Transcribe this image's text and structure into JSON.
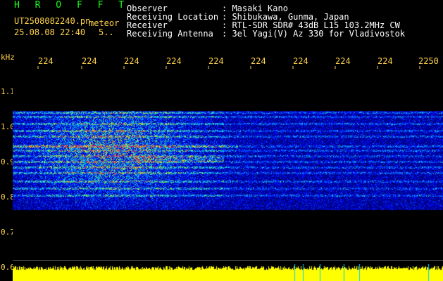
{
  "header": {
    "app_name": "H R O F F T",
    "filename": "UT2508082240.pn",
    "tag": "meteor",
    "datetime": "25.08.08 22:40",
    "datetime_suffix": "5..",
    "fields": [
      {
        "label": "Observer",
        "value": ": Masaki Kano"
      },
      {
        "label": "Receiving Location",
        "value": ": Shibukawa, Gunma, Japan"
      },
      {
        "label": "Receiver",
        "value": ": RTL-SDR SDR# 43dB L15 103.2MHz CW"
      },
      {
        "label": "Receiving Antenna",
        "value": ": 3el Yagi(V) Az 330 for Vladivostok"
      }
    ]
  },
  "axes": {
    "unit": "kHz",
    "x_ticks": [
      "224",
      "224",
      "224",
      "224",
      "224",
      "224",
      "224",
      "224",
      "224",
      "2250"
    ],
    "y_ticks": [
      "1.1",
      "1.0",
      "0.9",
      "0.8",
      "0.7",
      "0.6"
    ]
  },
  "colors": {
    "background": "#000000",
    "header_text": "#ffffff",
    "app_name": "#19ff19",
    "axis_text": "#ffd24a",
    "level_bar": "#ffff00"
  }
}
